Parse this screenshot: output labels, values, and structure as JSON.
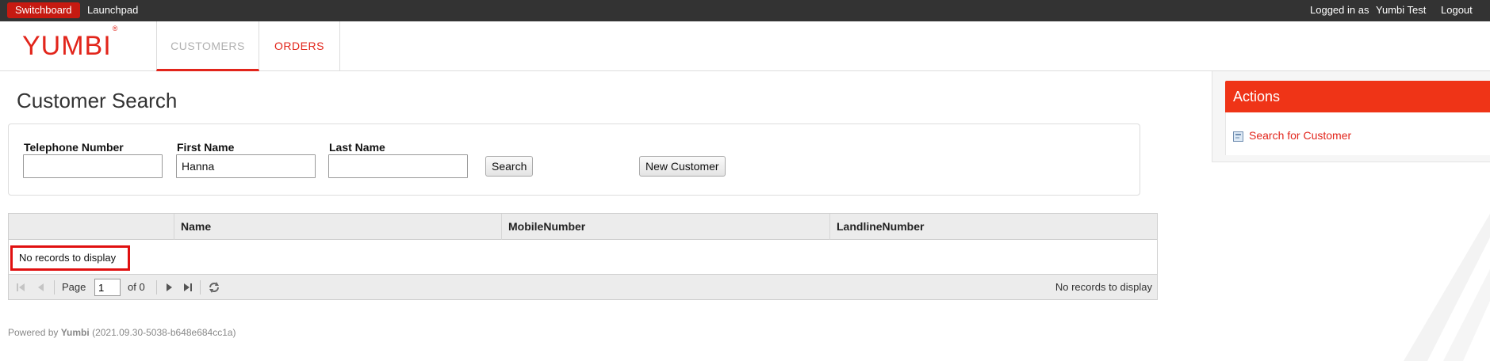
{
  "topbar": {
    "tabs": [
      {
        "label": "Switchboard",
        "active": true
      },
      {
        "label": "Launchpad",
        "active": false
      }
    ],
    "logged_in_as": "Logged in as",
    "user": "Yumbi Test",
    "logout": "Logout"
  },
  "header": {
    "logo": "YUMBI",
    "logo_mark": "®",
    "nav": [
      {
        "label": "CUSTOMERS",
        "active": true
      },
      {
        "label": "ORDERS",
        "active": false
      }
    ]
  },
  "page": {
    "title": "Customer Search"
  },
  "search": {
    "telephone_label": "Telephone Number",
    "telephone_value": "",
    "first_name_label": "First Name",
    "first_name_value": "Hanna",
    "last_name_label": "Last Name",
    "last_name_value": "",
    "search_button": "Search",
    "new_customer_button": "New Customer"
  },
  "grid": {
    "columns": [
      "Name",
      "MobileNumber",
      "LandlineNumber"
    ],
    "empty_message": "No records to display",
    "pager": {
      "page_label": "Page",
      "page_value": "1",
      "of_label": "of 0",
      "status": "No records to display"
    }
  },
  "footer": {
    "powered_by": "Powered by",
    "brand": "Yumbi",
    "version": "(2021.09.30-5038-b648e684cc1a)"
  },
  "actions": {
    "title": "Actions",
    "items": [
      {
        "label": "Search for Customer",
        "icon": "search-form-icon"
      }
    ]
  },
  "colors": {
    "brand_red": "#e2251b",
    "actions_header": "#ef3417",
    "topbar": "#333333",
    "highlight_border": "#e01010"
  }
}
